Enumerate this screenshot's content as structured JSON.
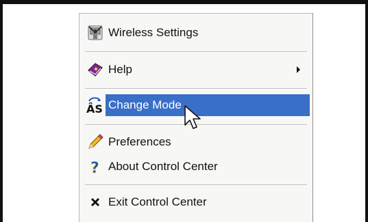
{
  "menu": {
    "items": [
      {
        "label": "Wireless Settings",
        "icon": "wireless-icon"
      },
      {
        "label": "Help",
        "icon": "help-book-icon",
        "submenu": true
      },
      {
        "label": "Change Mode",
        "icon": "change-mode-icon",
        "selected": true
      },
      {
        "label": "Preferences",
        "icon": "pencil-icon"
      },
      {
        "label": "About Control Center",
        "icon": "question-icon"
      },
      {
        "label": "Exit Control Center",
        "icon": "close-x-icon"
      }
    ],
    "change_mode_icon_text": "ÂS"
  },
  "colors": {
    "selection": "#3a6fc8",
    "menu_background": "#f7f7f5",
    "frame": "#111111"
  }
}
